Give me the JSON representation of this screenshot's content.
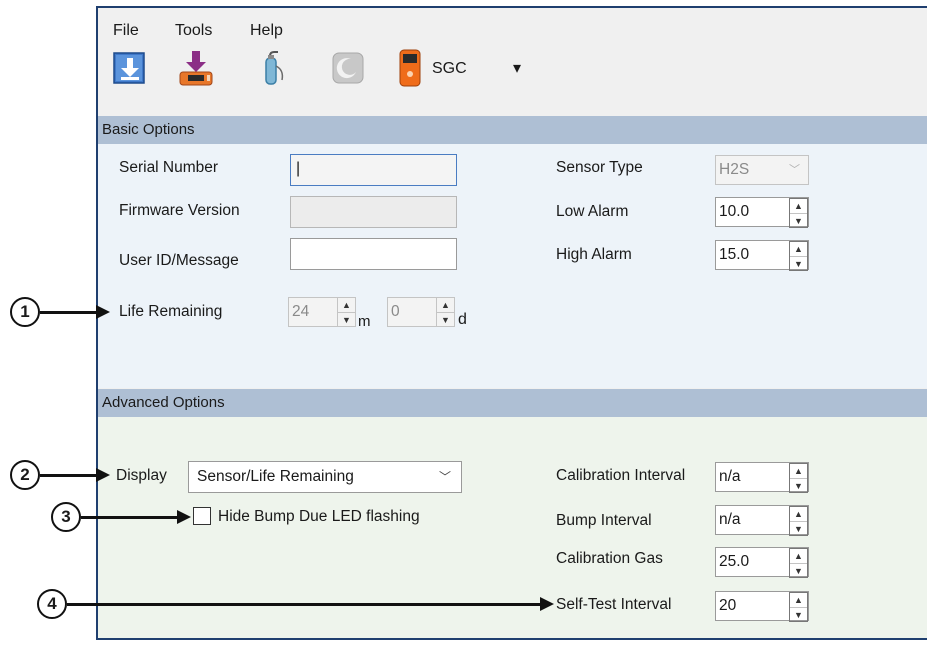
{
  "menu": {
    "file": "File",
    "tools": "Tools",
    "help": "Help"
  },
  "toolbar": {
    "device_label": "SGC",
    "dropdown_glyph": "▾"
  },
  "basic": {
    "header": "Basic Options",
    "serial_label": "Serial Number",
    "serial_value": "|",
    "firmware_label": "Firmware Version",
    "firmware_value": "",
    "userid_label": "User ID/Message",
    "userid_value": "",
    "life_label": "Life Remaining",
    "life_months": "24",
    "life_m_unit": "m",
    "life_days": "0",
    "life_d_unit": "d",
    "sensor_type_label": "Sensor Type",
    "sensor_type_value": "H2S",
    "low_alarm_label": "Low Alarm",
    "low_alarm_value": "10.0",
    "high_alarm_label": "High Alarm",
    "high_alarm_value": "15.0"
  },
  "advanced": {
    "header": "Advanced Options",
    "display_label": "Display",
    "display_value": "Sensor/Life Remaining",
    "hide_bump_label": "Hide Bump Due LED flashing",
    "hide_bump_checked": false,
    "cal_interval_label": "Calibration Interval",
    "cal_interval_value": "n/a",
    "bump_interval_label": "Bump Interval",
    "bump_interval_value": "n/a",
    "cal_gas_label": "Calibration Gas",
    "cal_gas_value": "25.0",
    "selftest_label": "Self-Test Interval",
    "selftest_value": "20"
  },
  "callouts": [
    "1",
    "2",
    "3",
    "4"
  ],
  "colors": {
    "section_header": "#aebfd4",
    "panel_basic": "#edf3f9",
    "panel_advanced": "#eef4ec",
    "window_border": "#1f3f6f"
  }
}
